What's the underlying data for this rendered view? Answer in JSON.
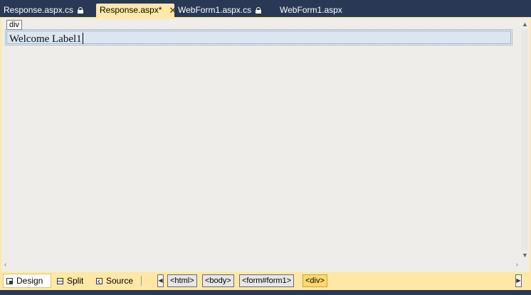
{
  "tabs": [
    {
      "label": "Response.aspx.cs",
      "locked": true,
      "active": false
    },
    {
      "label": "Response.aspx*",
      "locked": false,
      "active": true
    },
    {
      "label": "WebForm1.aspx.cs",
      "locked": true,
      "active": false
    },
    {
      "label": "WebForm1.aspx",
      "locked": false,
      "active": false
    }
  ],
  "designer": {
    "element_tag": "div",
    "label_text": "Welcome Label1"
  },
  "view_buttons": {
    "design": "Design",
    "split": "Split",
    "source": "Source"
  },
  "breadcrumb": [
    "<html>",
    "<body>",
    "<form#form1>",
    "<div>"
  ],
  "colors": {
    "accent": "#ffe8a6",
    "chrome": "#293955",
    "surface": "#efedea",
    "selected_crumb": "#ffd86f"
  },
  "icons": {
    "lock": "lock-icon",
    "close": "close-icon",
    "design": "design-view-icon",
    "split": "split-view-icon",
    "source": "source-view-icon"
  }
}
